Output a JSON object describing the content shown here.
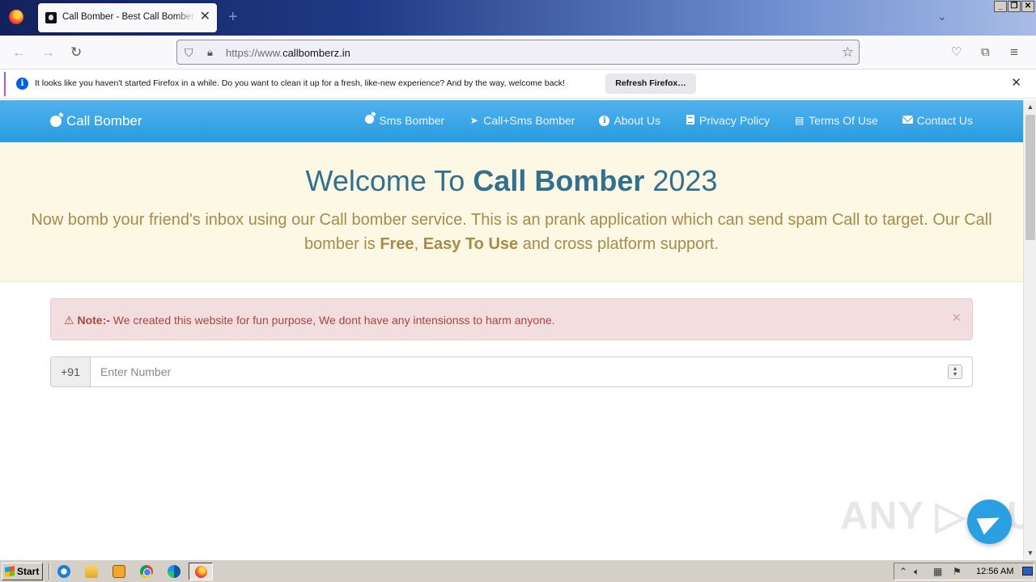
{
  "browser": {
    "tab_title": "Call Bomber - Best Call Bomber Online",
    "tab_close": "✕",
    "new_tab": "+",
    "url_prefix": "https://www.",
    "url_domain": "callbomberz.in",
    "window_buttons": {
      "minimize": "_",
      "restore": "❐",
      "close": "✕"
    }
  },
  "notification": {
    "text": "It looks like you haven't started Firefox in a while. Do you want to clean it up for a fresh, like-new experience? And by the way, welcome back!",
    "button": "Refresh Firefox…",
    "close": "✕"
  },
  "site": {
    "brand": "Call Bomber",
    "menu": [
      {
        "label": "Sms Bomber",
        "icon": "bomb-icon"
      },
      {
        "label": "Call+Sms Bomber",
        "icon": "paper-plane-icon"
      },
      {
        "label": "About Us",
        "icon": "info-circle-icon"
      },
      {
        "label": "Privacy Policy",
        "icon": "document-icon"
      },
      {
        "label": "Terms Of Use",
        "icon": "list-alt-icon"
      },
      {
        "label": "Contact Us",
        "icon": "envelope-icon"
      }
    ],
    "heading_pre": "Welcome To ",
    "heading_bold": "Call Bomber",
    "heading_post": " 2023",
    "intro_1": "Now bomb your friend's inbox using our Call bomber service. This is an prank application which can send spam Call to target. Our Call bomber is ",
    "intro_free": "Free",
    "intro_comma": ", ",
    "intro_easy": "Easy To Use",
    "intro_2": " and cross platform support.",
    "alert_label": "Note:-",
    "alert_text": " We created this website for fun purpose, We dont have any intensionss to harm anyone.",
    "alert_close": "×",
    "country_code": "+91",
    "number_placeholder": "Enter Number",
    "watermark": "ANY ▷ RUN"
  },
  "taskbar": {
    "start": "Start",
    "clock": "12:56 AM"
  },
  "colors": {
    "navbar": "#2a9be0",
    "jumbotron_bg": "#fcf8e3",
    "heading": "#31708f",
    "intro_text": "#a88a4b",
    "alert_bg": "#f2dede",
    "alert_text": "#a94442",
    "telegram": "#2aa0e2"
  }
}
